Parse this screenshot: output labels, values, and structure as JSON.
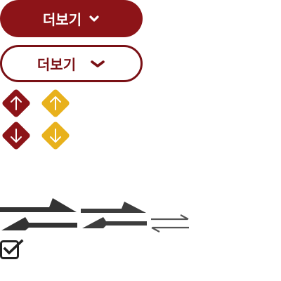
{
  "buttons": {
    "more_filled_label": "더보기",
    "more_outline_label": "더보기"
  },
  "icons": {
    "chevron": "chevron-down-icon",
    "arrow_up": "arrow-up-icon",
    "arrow_down": "arrow-down-icon",
    "swap": "swap-arrows-icon",
    "checkbox": "checkbox-checked-icon"
  },
  "colors": {
    "primary_red": "#8d1418",
    "outline_red": "#7a1015",
    "accent_gold": "#e8b11c",
    "icon_dark": "#333333",
    "white": "#ffffff"
  },
  "checkbox": {
    "checked": true
  }
}
